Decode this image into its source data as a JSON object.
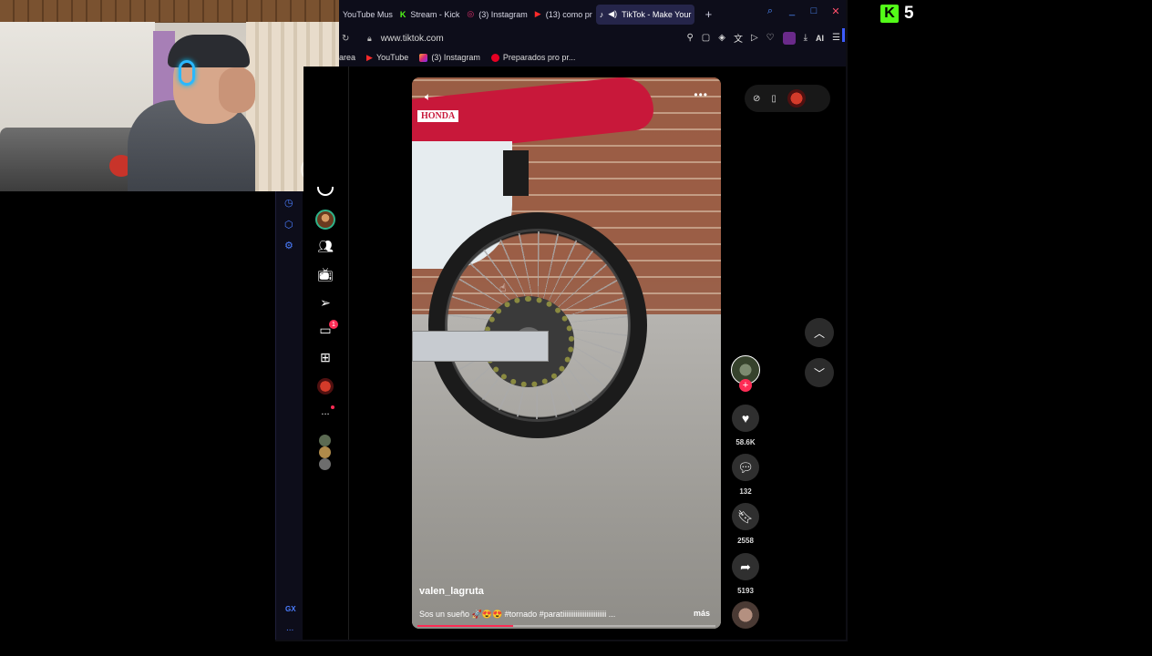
{
  "tabs": [
    {
      "label": "YouTube Mus",
      "icon": "youtube-music-icon",
      "active": false
    },
    {
      "label": "Stream - Kick",
      "icon": "kick-icon",
      "active": false
    },
    {
      "label": "(3) Instagram",
      "icon": "instagram-icon",
      "active": false
    },
    {
      "label": "(13) como pr",
      "icon": "youtube-icon",
      "active": false
    },
    {
      "label": "TikTok - Make Your",
      "icon": "tiktok-icon",
      "active": true
    }
  ],
  "new_tab": "+",
  "address": {
    "url": "www.tiktok.com",
    "ai_label": "AI"
  },
  "bookmarks": [
    {
      "label": "area",
      "icon": ""
    },
    {
      "label": "YouTube",
      "icon": "youtube-icon"
    },
    {
      "label": "(3) Instagram",
      "icon": "instagram-icon"
    },
    {
      "label": "Preparados pro pr...",
      "icon": "pinterest-icon"
    }
  ],
  "gx_sidebar": {
    "gx_label": "GX",
    "more": "..."
  },
  "tiktok_nav": {
    "messages_badge": "1",
    "more": "..."
  },
  "video": {
    "brand_text": "HONDA",
    "username": "valen_lagruta",
    "description": "Sos un sueño 🚀😍😍 #tornado #paratiiiiiiiiiiiiiiiiiiiiiiii ...",
    "more_label": "más",
    "progress": 0.32
  },
  "actions": {
    "likes": "58.6K",
    "comments": "132",
    "saves": "2558",
    "shares": "5193",
    "follow": "+"
  },
  "kick_overlay": {
    "viewers": "5"
  },
  "colors": {
    "accent": "#fe2c55",
    "gx_blue": "#4b7dff",
    "kick_green": "#53fc18"
  }
}
